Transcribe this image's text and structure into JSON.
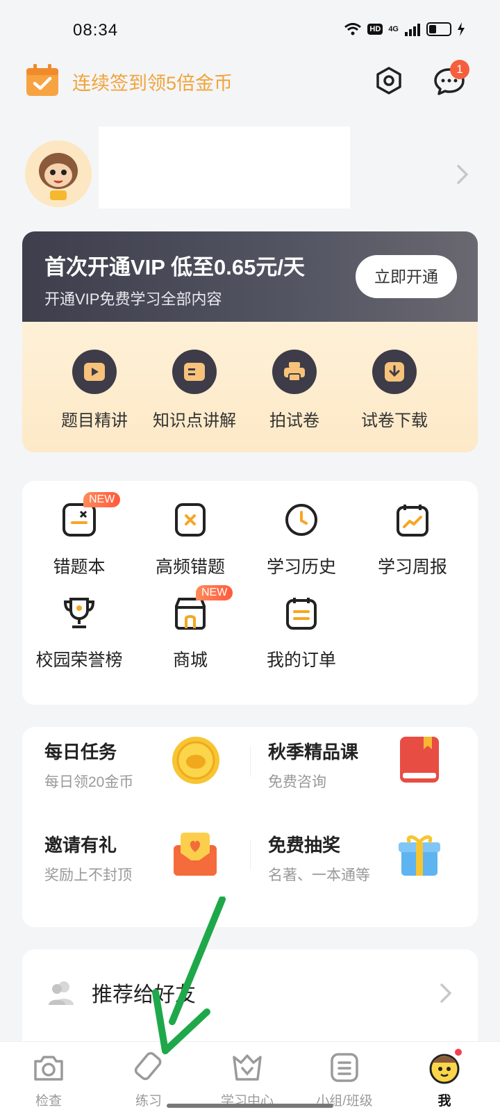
{
  "status_bar": {
    "time": "08:34",
    "hd": "HD",
    "network": "4G"
  },
  "header": {
    "checkin_text": "连续签到领5倍金币",
    "message_badge": "1"
  },
  "vip": {
    "title": "首次开通VIP 低至0.65元/天",
    "subtitle": "开通VIP免费学习全部内容",
    "button": "立即开通",
    "features": [
      {
        "label": "题目精讲",
        "icon": "play-icon"
      },
      {
        "label": "知识点讲解",
        "icon": "card-icon"
      },
      {
        "label": "拍试卷",
        "icon": "printer-icon"
      },
      {
        "label": "试卷下载",
        "icon": "download-icon"
      }
    ]
  },
  "tools": {
    "items": [
      {
        "label": "错题本",
        "icon": "mistake-book-icon",
        "badge": "NEW"
      },
      {
        "label": "高频错题",
        "icon": "frequent-mistake-icon"
      },
      {
        "label": "学习历史",
        "icon": "clock-icon"
      },
      {
        "label": "学习周报",
        "icon": "weekly-report-icon"
      },
      {
        "label": "校园荣誉榜",
        "icon": "trophy-icon"
      },
      {
        "label": "商城",
        "icon": "shop-icon",
        "badge": "NEW"
      },
      {
        "label": "我的订单",
        "icon": "order-icon"
      }
    ]
  },
  "tasks": {
    "items": [
      {
        "title": "每日任务",
        "subtitle": "每日领20金币",
        "icon": "coin-icon"
      },
      {
        "title": "秋季精品课",
        "subtitle": "免费咨询",
        "icon": "book-icon"
      },
      {
        "title": "邀请有礼",
        "subtitle": "奖励上不封顶",
        "icon": "envelope-icon"
      },
      {
        "title": "免费抽奖",
        "subtitle": "名著、一本通等",
        "icon": "gift-icon"
      }
    ]
  },
  "recommend": {
    "label": "推荐给好友"
  },
  "bottom_nav": {
    "items": [
      {
        "label": "检查",
        "icon": "camera-icon"
      },
      {
        "label": "练习",
        "icon": "pencil-icon"
      },
      {
        "label": "学习中心",
        "icon": "study-center-icon"
      },
      {
        "label": "小组/班级",
        "icon": "group-icon"
      },
      {
        "label": "我",
        "icon": "me-avatar-icon",
        "active": true
      }
    ]
  },
  "colors": {
    "accent_orange": "#f0a43a",
    "badge_red": "#f55f3d",
    "vip_dark": "#3e3e4c",
    "arrow_green": "#1fa84a"
  }
}
